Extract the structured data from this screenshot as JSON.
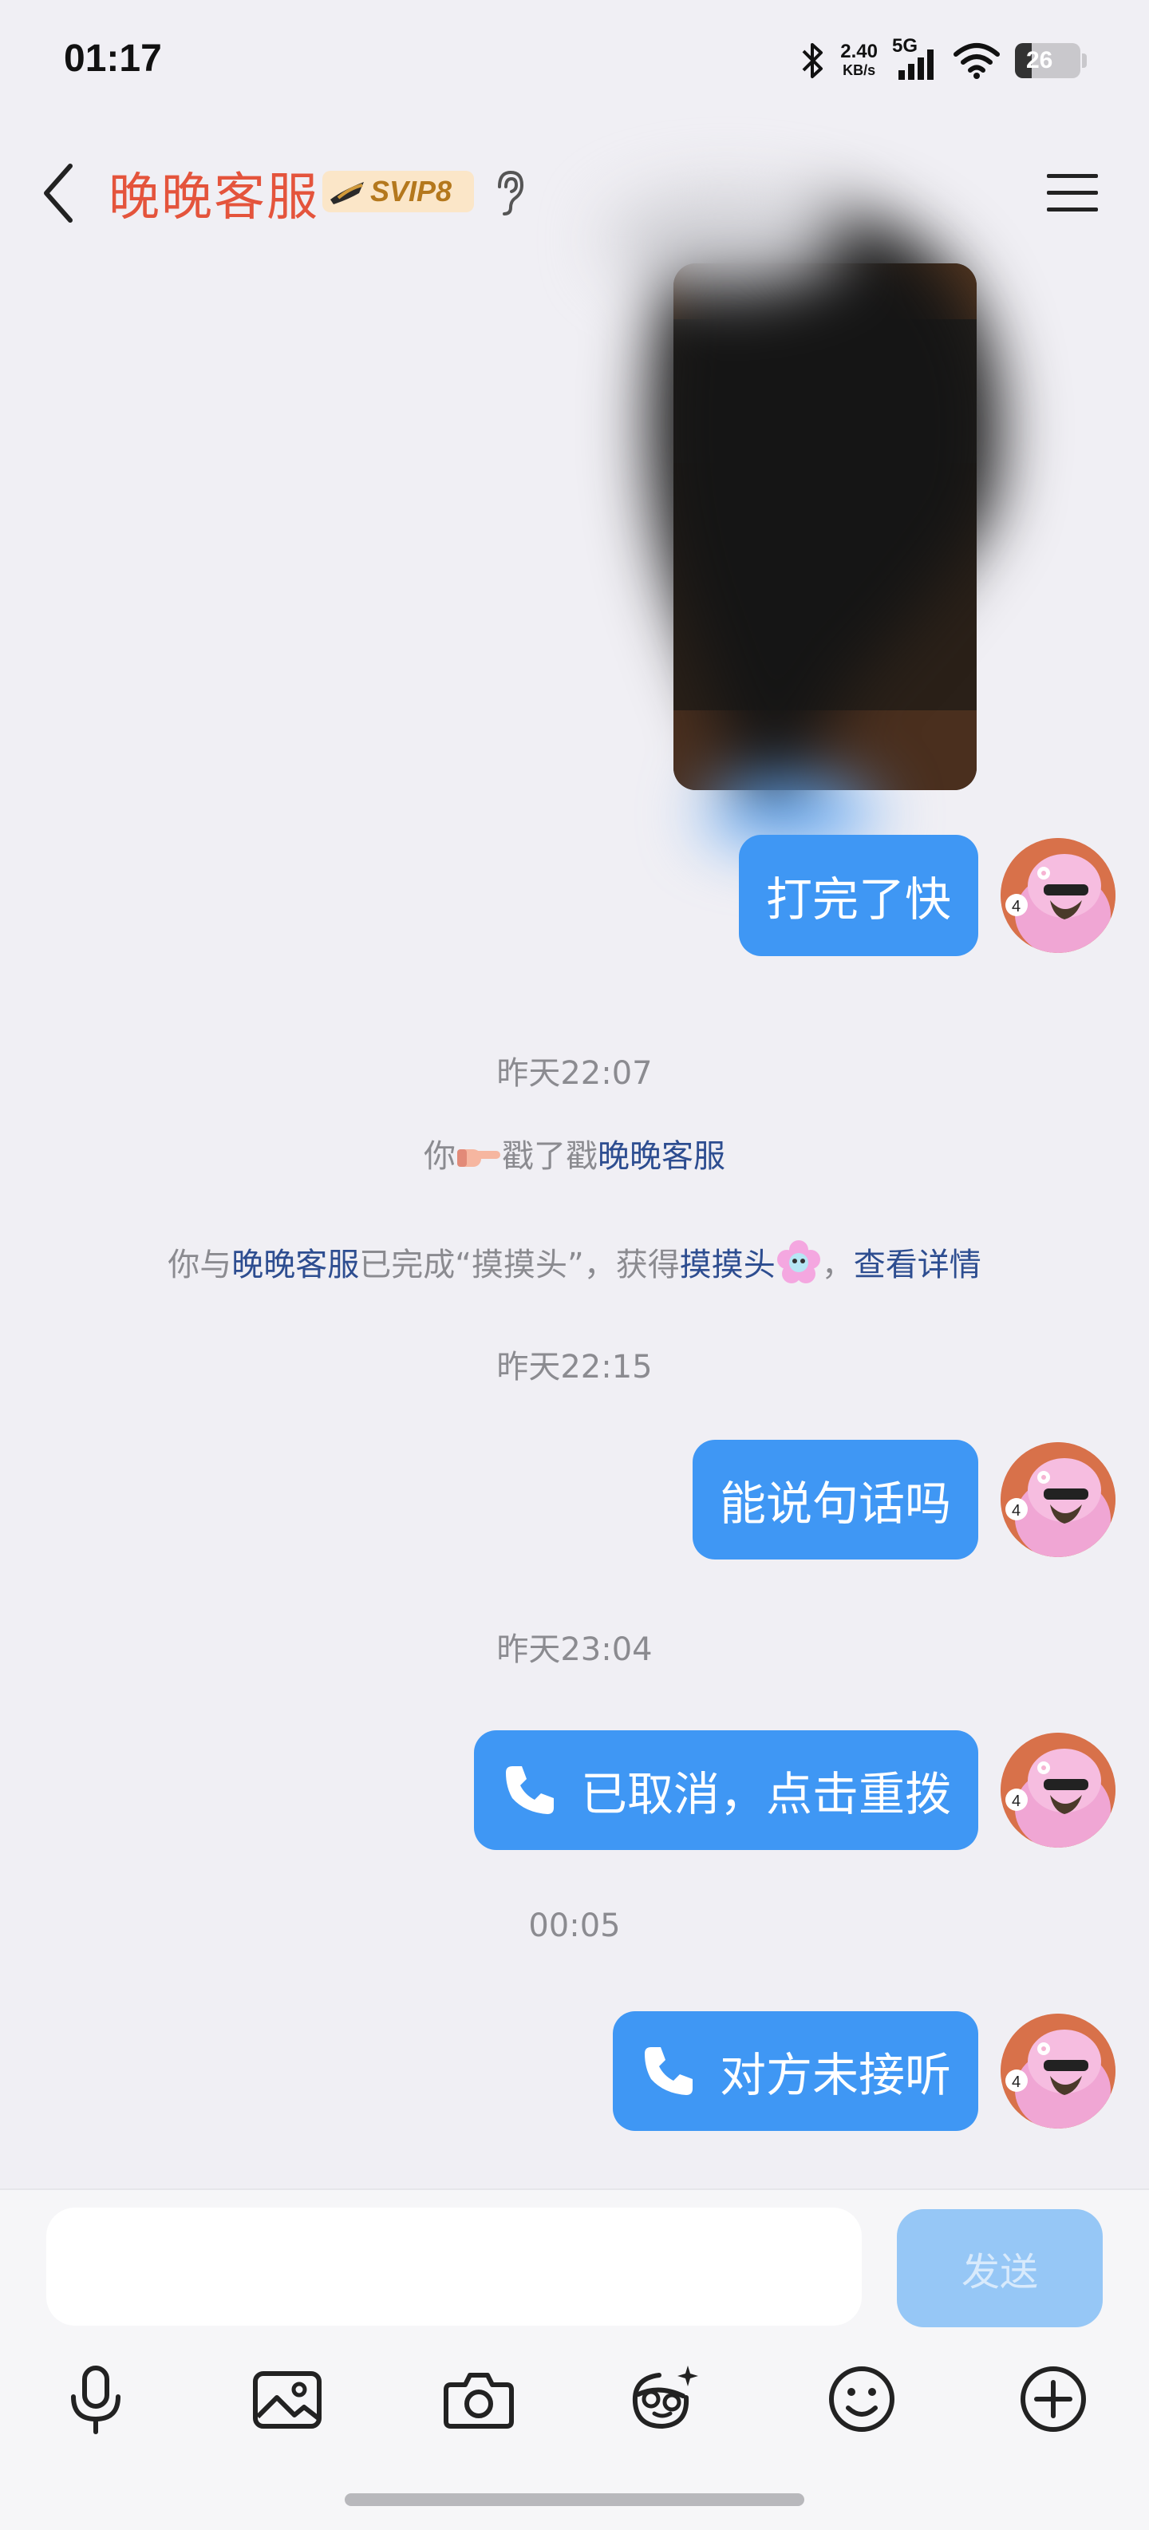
{
  "status_bar": {
    "time": "01:17",
    "net_speed_value": "2.40",
    "net_speed_unit": "KB/s",
    "network": "5G",
    "battery_level": "26",
    "icons": [
      "bluetooth-icon",
      "signal-icon",
      "wifi-icon",
      "battery-icon"
    ]
  },
  "header": {
    "contact_name": "晚晚客服",
    "vip_label": "SVIP8",
    "icons": [
      "back-arrow-icon",
      "vip-hat-icon",
      "ear-icon",
      "menu-icon"
    ]
  },
  "messages": {
    "m1_text": "打完了快",
    "time1": "昨天22:07",
    "poke_prefix": "你",
    "poke_action": "戳了戳",
    "poke_target": "晚晚客服",
    "achv_prefix": "你与",
    "achv_name": "晚晚客服",
    "achv_mid": "已完成“摸摸头”，获得",
    "achv_item": "摸摸头",
    "achv_sep": "，",
    "achv_link": "查看详情",
    "time2": "昨天22:15",
    "m2_text": "能说句话吗",
    "time3": "昨天23:04",
    "call1_text": "已取消，点击重拨",
    "time4": "00:05",
    "call2_text": "对方未接听"
  },
  "composer": {
    "input_value": "",
    "send_label": "发送",
    "tools": [
      "microphone-icon",
      "image-icon",
      "camera-icon",
      "sticker-face-icon",
      "emoji-icon",
      "plus-icon"
    ]
  },
  "colors": {
    "bubble": "#3f97f4",
    "name": "#e4543c",
    "link": "#2d4d90",
    "send_disabled": "#96c7f6"
  }
}
